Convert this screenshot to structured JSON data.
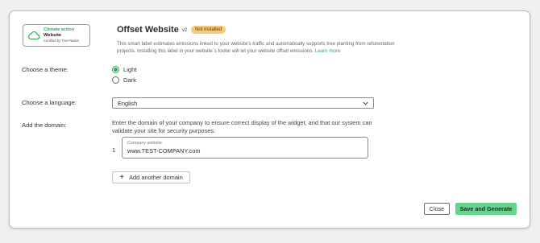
{
  "widget_badge": {
    "line1": "Climate action",
    "line2": "Website",
    "line3": "Certified by Tree-Nation",
    "icon": "cloud-icon",
    "accent": "#2eaa5c"
  },
  "header": {
    "title": "Offset Website",
    "version": "v2",
    "status": "Not installed",
    "status_color": "#f7c97a",
    "description": "This smart label estimates emissions linked to your website's traffic and automatically supports tree planting from reforestation projects. Installing this label in your website´s footer will let your website offset emissions.",
    "learn_more": "Learn more"
  },
  "theme": {
    "label": "Choose a theme:",
    "options": [
      {
        "label": "Light",
        "checked": true
      },
      {
        "label": "Dark",
        "checked": false
      }
    ]
  },
  "language": {
    "label": "Choose a language:",
    "value": "English",
    "icon": "chevron-down-icon"
  },
  "domain": {
    "label": "Add the domain:",
    "hint": "Enter the domain of your company to ensure correct display of the widget, and that our system can validate your site for security purposes.",
    "rows": [
      {
        "index": "1",
        "field_label": "Company website",
        "value": "www.TEST-COMPANY.com"
      }
    ],
    "add_label": "Add another domain"
  },
  "footer": {
    "close_label": "Close",
    "save_label": "Save and Generate",
    "save_color": "#66d58e"
  }
}
